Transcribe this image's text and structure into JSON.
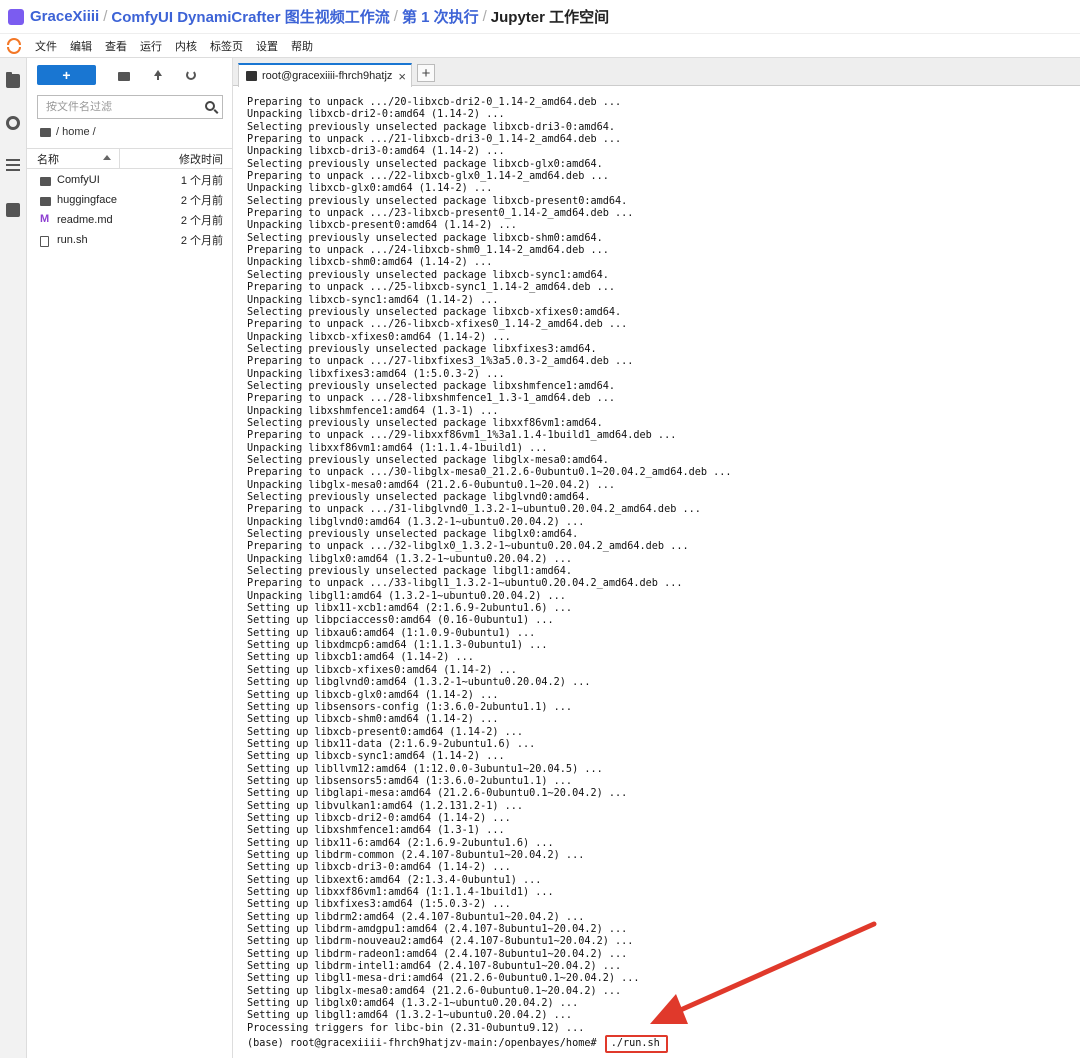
{
  "breadcrumb": {
    "items": [
      "GraceXiiii",
      "ComfyUI DynamiCrafter 图生视频工作流",
      "第 1 次执行",
      "Jupyter 工作空间"
    ],
    "separator": "/"
  },
  "menubar": {
    "items": [
      "文件",
      "编辑",
      "查看",
      "运行",
      "内核",
      "标签页",
      "设置",
      "帮助"
    ]
  },
  "filebrowser": {
    "new_label": "+",
    "search_placeholder": "按文件名过滤",
    "path": "/ home /",
    "col_name": "名称",
    "col_modified": "修改时间",
    "files": [
      {
        "name": "ComfyUI",
        "time": "1 个月前",
        "icon": "folder-icon"
      },
      {
        "name": "huggingface",
        "time": "2 个月前",
        "icon": "folder-icon"
      },
      {
        "name": "readme.md",
        "time": "2 个月前",
        "icon": "markdown-icon"
      },
      {
        "name": "run.sh",
        "time": "2 个月前",
        "icon": "file-icon"
      }
    ]
  },
  "tab": {
    "title": "root@gracexiiii-fhrch9hatjz",
    "close": "×",
    "add": "+"
  },
  "terminal": {
    "lines": [
      "Preparing to unpack .../20-libxcb-dri2-0_1.14-2_amd64.deb ...",
      "Unpacking libxcb-dri2-0:amd64 (1.14-2) ...",
      "Selecting previously unselected package libxcb-dri3-0:amd64.",
      "Preparing to unpack .../21-libxcb-dri3-0_1.14-2_amd64.deb ...",
      "Unpacking libxcb-dri3-0:amd64 (1.14-2) ...",
      "Selecting previously unselected package libxcb-glx0:amd64.",
      "Preparing to unpack .../22-libxcb-glx0_1.14-2_amd64.deb ...",
      "Unpacking libxcb-glx0:amd64 (1.14-2) ...",
      "Selecting previously unselected package libxcb-present0:amd64.",
      "Preparing to unpack .../23-libxcb-present0_1.14-2_amd64.deb ...",
      "Unpacking libxcb-present0:amd64 (1.14-2) ...",
      "Selecting previously unselected package libxcb-shm0:amd64.",
      "Preparing to unpack .../24-libxcb-shm0_1.14-2_amd64.deb ...",
      "Unpacking libxcb-shm0:amd64 (1.14-2) ...",
      "Selecting previously unselected package libxcb-sync1:amd64.",
      "Preparing to unpack .../25-libxcb-sync1_1.14-2_amd64.deb ...",
      "Unpacking libxcb-sync1:amd64 (1.14-2) ...",
      "Selecting previously unselected package libxcb-xfixes0:amd64.",
      "Preparing to unpack .../26-libxcb-xfixes0_1.14-2_amd64.deb ...",
      "Unpacking libxcb-xfixes0:amd64 (1.14-2) ...",
      "Selecting previously unselected package libxfixes3:amd64.",
      "Preparing to unpack .../27-libxfixes3_1%3a5.0.3-2_amd64.deb ...",
      "Unpacking libxfixes3:amd64 (1:5.0.3-2) ...",
      "Selecting previously unselected package libxshmfence1:amd64.",
      "Preparing to unpack .../28-libxshmfence1_1.3-1_amd64.deb ...",
      "Unpacking libxshmfence1:amd64 (1.3-1) ...",
      "Selecting previously unselected package libxxf86vm1:amd64.",
      "Preparing to unpack .../29-libxxf86vm1_1%3a1.1.4-1build1_amd64.deb ...",
      "Unpacking libxxf86vm1:amd64 (1:1.1.4-1build1) ...",
      "Selecting previously unselected package libglx-mesa0:amd64.",
      "Preparing to unpack .../30-libglx-mesa0_21.2.6-0ubuntu0.1~20.04.2_amd64.deb ...",
      "Unpacking libglx-mesa0:amd64 (21.2.6-0ubuntu0.1~20.04.2) ...",
      "Selecting previously unselected package libglvnd0:amd64.",
      "Preparing to unpack .../31-libglvnd0_1.3.2-1~ubuntu0.20.04.2_amd64.deb ...",
      "Unpacking libglvnd0:amd64 (1.3.2-1~ubuntu0.20.04.2) ...",
      "Selecting previously unselected package libglx0:amd64.",
      "Preparing to unpack .../32-libglx0_1.3.2-1~ubuntu0.20.04.2_amd64.deb ...",
      "Unpacking libglx0:amd64 (1.3.2-1~ubuntu0.20.04.2) ...",
      "Selecting previously unselected package libgl1:amd64.",
      "Preparing to unpack .../33-libgl1_1.3.2-1~ubuntu0.20.04.2_amd64.deb ...",
      "Unpacking libgl1:amd64 (1.3.2-1~ubuntu0.20.04.2) ...",
      "Setting up libx11-xcb1:amd64 (2:1.6.9-2ubuntu1.6) ...",
      "Setting up libpciaccess0:amd64 (0.16-0ubuntu1) ...",
      "Setting up libxau6:amd64 (1:1.0.9-0ubuntu1) ...",
      "Setting up libxdmcp6:amd64 (1:1.1.3-0ubuntu1) ...",
      "Setting up libxcb1:amd64 (1.14-2) ...",
      "Setting up libxcb-xfixes0:amd64 (1.14-2) ...",
      "Setting up libglvnd0:amd64 (1.3.2-1~ubuntu0.20.04.2) ...",
      "Setting up libxcb-glx0:amd64 (1.14-2) ...",
      "Setting up libsensors-config (1:3.6.0-2ubuntu1.1) ...",
      "Setting up libxcb-shm0:amd64 (1.14-2) ...",
      "Setting up libxcb-present0:amd64 (1.14-2) ...",
      "Setting up libx11-data (2:1.6.9-2ubuntu1.6) ...",
      "Setting up libxcb-sync1:amd64 (1.14-2) ...",
      "Setting up libllvm12:amd64 (1:12.0.0-3ubuntu1~20.04.5) ...",
      "Setting up libsensors5:amd64 (1:3.6.0-2ubuntu1.1) ...",
      "Setting up libglapi-mesa:amd64 (21.2.6-0ubuntu0.1~20.04.2) ...",
      "Setting up libvulkan1:amd64 (1.2.131.2-1) ...",
      "Setting up libxcb-dri2-0:amd64 (1.14-2) ...",
      "Setting up libxshmfence1:amd64 (1.3-1) ...",
      "Setting up libx11-6:amd64 (2:1.6.9-2ubuntu1.6) ...",
      "Setting up libdrm-common (2.4.107-8ubuntu1~20.04.2) ...",
      "Setting up libxcb-dri3-0:amd64 (1.14-2) ...",
      "Setting up libxext6:amd64 (2:1.3.4-0ubuntu1) ...",
      "Setting up libxxf86vm1:amd64 (1:1.1.4-1build1) ...",
      "Setting up libxfixes3:amd64 (1:5.0.3-2) ...",
      "Setting up libdrm2:amd64 (2.4.107-8ubuntu1~20.04.2) ...",
      "Setting up libdrm-amdgpu1:amd64 (2.4.107-8ubuntu1~20.04.2) ...",
      "Setting up libdrm-nouveau2:amd64 (2.4.107-8ubuntu1~20.04.2) ...",
      "Setting up libdrm-radeon1:amd64 (2.4.107-8ubuntu1~20.04.2) ...",
      "Setting up libdrm-intel1:amd64 (2.4.107-8ubuntu1~20.04.2) ...",
      "Setting up libgl1-mesa-dri:amd64 (21.2.6-0ubuntu0.1~20.04.2) ...",
      "Setting up libglx-mesa0:amd64 (21.2.6-0ubuntu0.1~20.04.2) ...",
      "Setting up libglx0:amd64 (1.3.2-1~ubuntu0.20.04.2) ...",
      "Setting up libgl1:amd64 (1.3.2-1~ubuntu0.20.04.2) ...",
      "Processing triggers for libc-bin (2.31-0ubuntu9.12) ..."
    ],
    "prompt": "(base) root@gracexiiii-fhrch9hatjzv-main:/openbayes/home# ",
    "command": "./run.sh"
  },
  "colors": {
    "accent": "#1976d2",
    "breadcrumb": "#3d63d6",
    "annotation": "#e0392b"
  }
}
